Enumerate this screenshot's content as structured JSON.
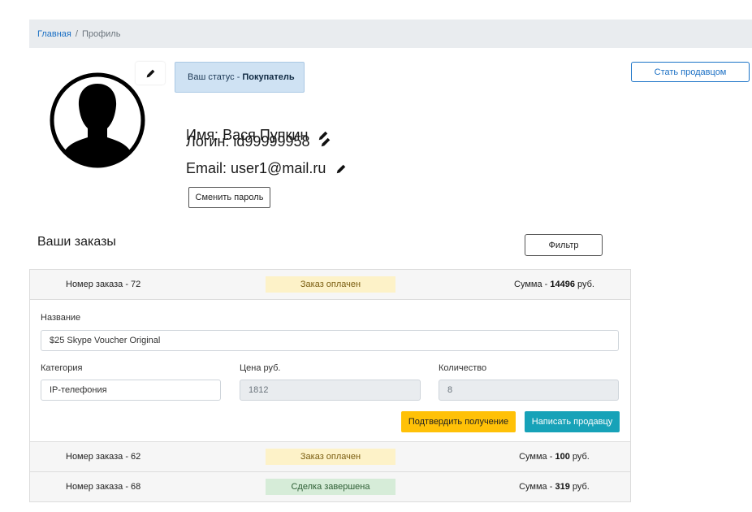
{
  "breadcrumb": {
    "home": "Главная",
    "separator": "/",
    "current": "Профиль"
  },
  "status": {
    "prefix": "Ваш статус -",
    "value": "Покупатель"
  },
  "become_seller_label": "Стать продавцом",
  "profile": {
    "name_label": "Имя:",
    "name": "Вася Пупкин",
    "login_label": "Логин:",
    "login": "id99999958",
    "email_label": "Email:",
    "email": "user1@mail.ru",
    "change_password_label": "Сменить пароль"
  },
  "orders_title": "Ваши заказы",
  "filter_label": "Фильтр",
  "orders": [
    {
      "number_text": "Номер заказа - 72",
      "status": "Заказ оплачен",
      "sum_prefix": "Сумма -",
      "sum": "14496",
      "sum_suffix": "руб.",
      "expanded": true
    },
    {
      "number_text": "Номер заказа - 62",
      "status": "Заказ оплачен",
      "sum_prefix": "Сумма -",
      "sum": "100",
      "sum_suffix": "руб."
    },
    {
      "number_text": "Номер заказа - 68",
      "status": "Сделка завершена",
      "sum_prefix": "Сумма -",
      "sum": "319",
      "sum_suffix": "руб."
    }
  ],
  "order_detail": {
    "name_label": "Название",
    "name_value": "$25 Skype Voucher Original",
    "category_label": "Категория",
    "category_value": "IP-телефония",
    "price_label": "Цена руб.",
    "price_value": "1812",
    "quantity_label": "Количество",
    "quantity_value": "8",
    "confirm_label": "Подтвердить получение",
    "write_seller_label": "Написать продавцу"
  },
  "colors": {
    "accent": "#1a6fc4",
    "warning": "#ffc107",
    "info": "#17a2b8",
    "paid_bg": "#fdf2c8",
    "done_bg": "#d6ecd8"
  },
  "icons": {
    "avatar": "user-silhouette-icon",
    "edit": "pencil-icon"
  }
}
